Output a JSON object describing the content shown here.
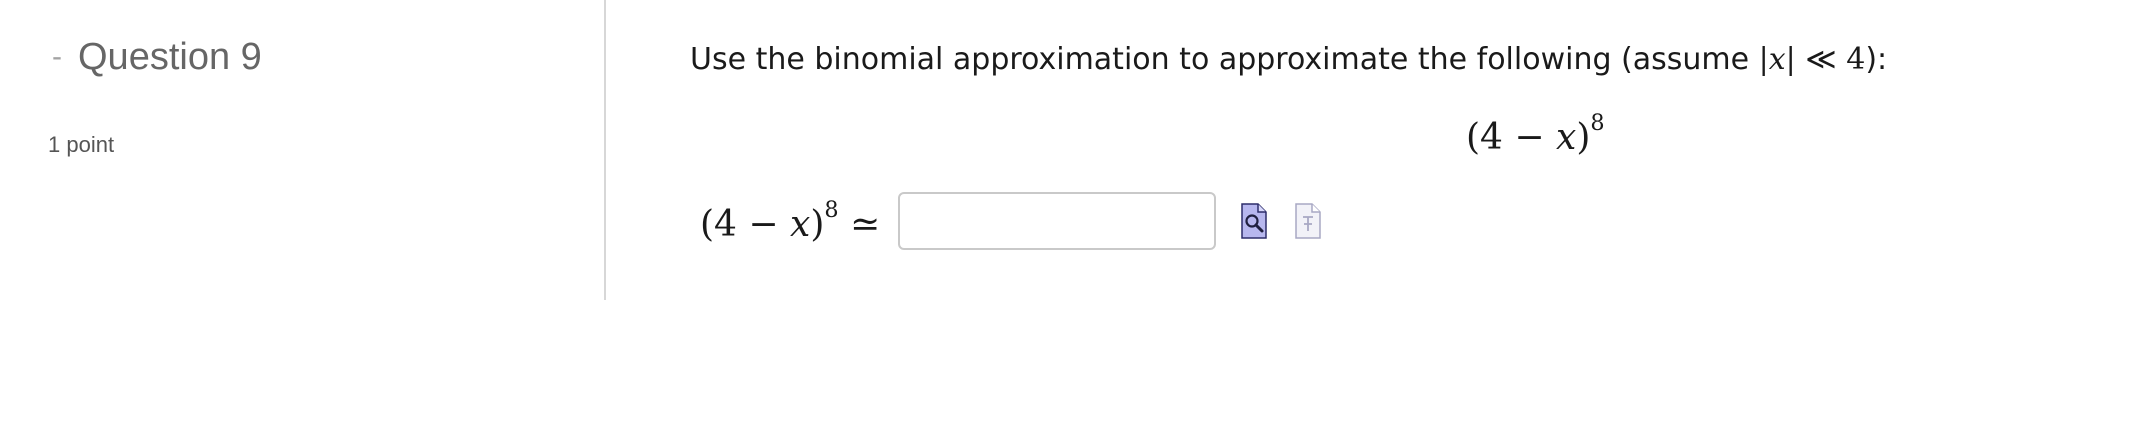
{
  "question": {
    "collapse_symbol": "-",
    "title": "Question 9",
    "points": "1 point"
  },
  "problem": {
    "intro_text": "Use the binomial approximation to approximate the following (assume ",
    "condition_bar_left": "|",
    "condition_variable": "x",
    "condition_bar_right": "|",
    "condition_relation": " ≪ ",
    "condition_value": "4",
    "intro_end": "):",
    "display_expression": {
      "open": "(4 − ",
      "variable": "x",
      "close": ")",
      "exponent": "8"
    },
    "answer_lhs": {
      "open": "(4 − ",
      "variable": "x",
      "close": ")",
      "exponent": "8",
      "relation": " ≃"
    },
    "answer_input": {
      "value": "",
      "placeholder": ""
    }
  },
  "icons": {
    "preview": "preview-answer-icon",
    "formula": "formula-editor-icon"
  },
  "colors": {
    "text": "#1a1a1a",
    "muted_title": "#666666",
    "divider": "#d7d7d7",
    "input_border": "#c9c9c9",
    "preview_icon_fill": "#b7b7ee",
    "formula_icon_fill": "#f2f2f8"
  }
}
